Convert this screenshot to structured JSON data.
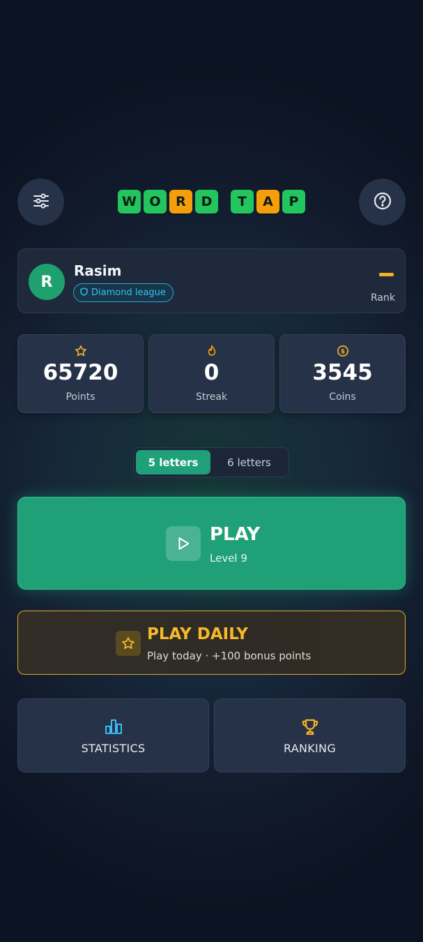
{
  "header": {
    "logo_letters": [
      "W",
      "O",
      "R",
      "D",
      "T",
      "A",
      "P"
    ],
    "settings_icon": "sliders-icon",
    "help_icon": "question-circle-icon"
  },
  "profile": {
    "avatar_initial": "R",
    "name": "Rasim",
    "league": "Diamond league",
    "rank_value": "—",
    "rank_label": "Rank"
  },
  "stats": [
    {
      "icon": "star-icon",
      "value": "65720",
      "label": "Points"
    },
    {
      "icon": "flame-icon",
      "value": "0",
      "label": "Streak"
    },
    {
      "icon": "coin-icon",
      "value": "3545",
      "label": "Coins"
    }
  ],
  "mode_toggle": {
    "options": [
      "5 letters",
      "6 letters"
    ],
    "selected": "5 letters"
  },
  "play": {
    "title": "PLAY",
    "subtitle": "Level 9"
  },
  "daily": {
    "title": "PLAY DAILY",
    "subtitle": "Play today · +100 bonus points"
  },
  "bottom": {
    "statistics_label": "STATISTICS",
    "ranking_label": "RANKING"
  },
  "colors": {
    "green_tile": "#22c55e",
    "orange_tile": "#f59e0b",
    "play_green": "#1fa077",
    "daily_gold": "#f7b928",
    "league_blue": "#35c0f0",
    "statistics_icon_blue": "#38bdf8",
    "ranking_icon_gold": "#f5b324"
  }
}
